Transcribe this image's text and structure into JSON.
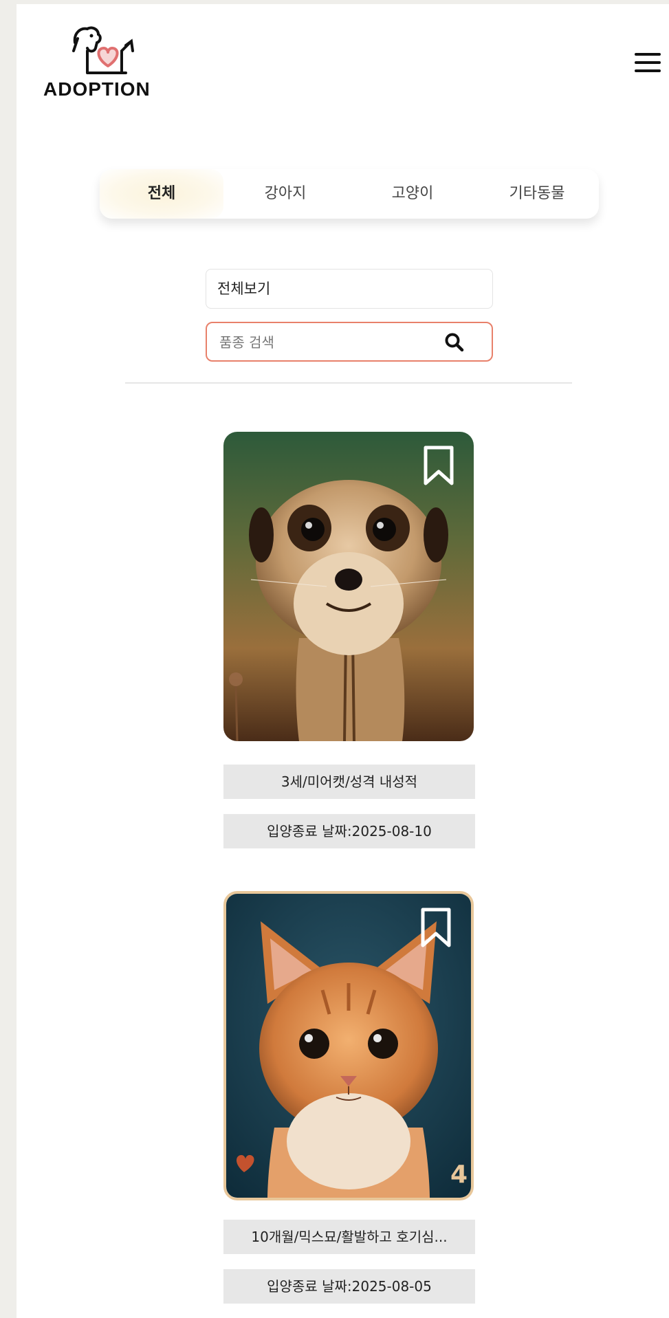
{
  "header": {
    "logo_text": "ADOPTION",
    "menu_icon": "hamburger-icon"
  },
  "tabs": [
    {
      "label": "전체",
      "active": true
    },
    {
      "label": "강아지",
      "active": false
    },
    {
      "label": "고양이",
      "active": false
    },
    {
      "label": "기타동물",
      "active": false
    }
  ],
  "filter": {
    "select_value": "전체보기"
  },
  "search": {
    "placeholder": "품종 검색",
    "icon": "search-icon"
  },
  "cards": [
    {
      "description": "3세/미어캣/성격 내성적",
      "adoption_end": "입양종료 날짜:2025-08-10",
      "photo": "meerkat"
    },
    {
      "description": "10개월/믹스묘/활발하고 호기심...",
      "adoption_end": "입양종료 날짜:2025-08-05",
      "photo": "kitten",
      "badge_number": "4"
    }
  ],
  "colors": {
    "accent": "#e8806a",
    "background": "#efeeea",
    "info_bg": "#e7e7e7"
  }
}
